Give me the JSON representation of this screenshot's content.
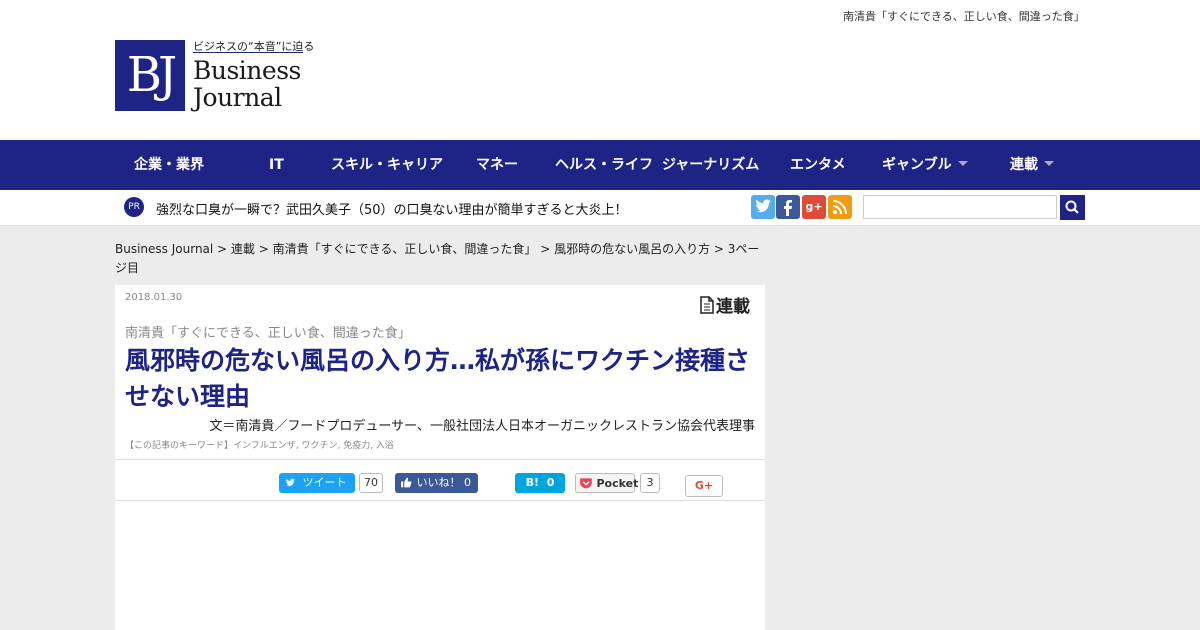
{
  "header": {
    "top_series": "南清貴「すぐにできる、正しい食、間違った食」",
    "logo": {
      "mark": "BJ",
      "tagline": "ビジネスの“本音”に迫る",
      "word1": "Business",
      "word2": "Journal"
    }
  },
  "nav": {
    "items": [
      {
        "label": "企業・業界",
        "caret": false
      },
      {
        "label": "IT",
        "caret": false
      },
      {
        "label": "スキル・キャリア",
        "caret": false
      },
      {
        "label": "マネー",
        "caret": false
      },
      {
        "label": "ヘルス・ライフ",
        "caret": false
      },
      {
        "label": "ジャーナリズム",
        "caret": false
      },
      {
        "label": "エンタメ",
        "caret": false
      },
      {
        "label": "ギャンブル",
        "caret": true
      },
      {
        "label": "連載",
        "caret": true
      }
    ]
  },
  "pr": {
    "badge": "PR",
    "text": "強烈な口臭が一瞬で？武田久美子（50）の口臭ない理由が簡単すぎると大炎上！"
  },
  "social": {
    "twitter": "t",
    "facebook": "f",
    "googleplus": "g+",
    "rss": "rss",
    "colors": {
      "twitter": "#55acee",
      "facebook": "#3b5998",
      "googleplus": "#dd4b39",
      "rss": "#f39c12"
    }
  },
  "search": {
    "placeholder": ""
  },
  "breadcrumb": {
    "home": "Business Journal",
    "sep": " > ",
    "c1": "連載",
    "c2": "南清貴「すぐにできる、正しい食、間違った食」",
    "c3": "風邪時の危ない風呂の入り方",
    "c4": "3ページ目"
  },
  "article": {
    "date": "2018.01.30",
    "badge": "連載",
    "series": "南清貴「すぐにできる、正しい食、間違った食」",
    "title": "風邪時の危ない風呂の入り方…私が孫にワクチン接種させない理由",
    "author": "文＝南清貴／フードプロデューサー、一般社団法人日本オーガニックレストラン協会代表理事",
    "keywords_label": "【この記事のキーワード】",
    "keywords": "インフルエンザ, ワクチン, 免疫力, 入浴"
  },
  "share": {
    "tweet_label": "ツイート",
    "tweet_count": "70",
    "like_label": "いいね！",
    "like_count": "0",
    "hatena_label": "B!",
    "hatena_count": "0",
    "pocket_label": "Pocket",
    "pocket_count": "3",
    "gplus_label": "G+"
  }
}
